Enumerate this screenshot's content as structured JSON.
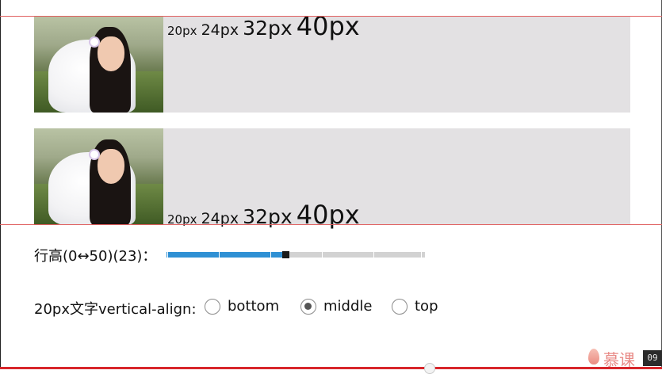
{
  "demo": {
    "font_sizes": [
      "20px",
      "24px",
      "32px",
      "40px"
    ]
  },
  "controls": {
    "line_height": {
      "label": "行高(0↔50)(23)：",
      "value": 23,
      "min": 0,
      "max": 50
    },
    "vertical_align": {
      "label": "20px文字vertical-align:",
      "options": [
        {
          "label": "bottom",
          "checked": false
        },
        {
          "label": "middle",
          "checked": true
        },
        {
          "label": "top",
          "checked": false
        }
      ]
    }
  },
  "branding": {
    "logo_text": "慕课",
    "page_number": "09"
  },
  "colors": {
    "demo_background": "#e3e1e3",
    "guide_line": "#e06060",
    "slider_fill": "#2f90d4",
    "slider_track": "#d2d2d2",
    "progress_bar": "#d8262b"
  }
}
